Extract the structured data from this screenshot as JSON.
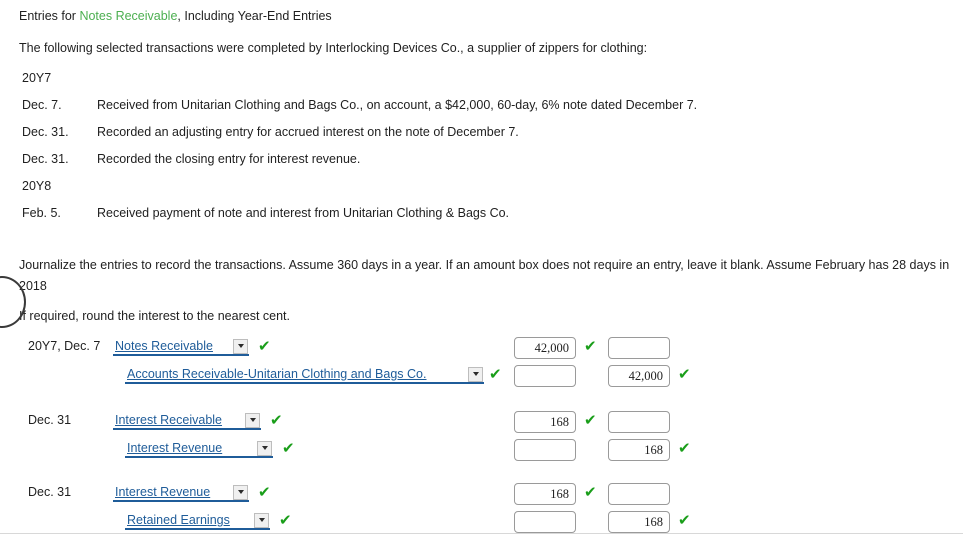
{
  "header": {
    "title_before": "Entries for ",
    "title_highlight": "Notes Receivable",
    "title_after": ", Including Year-End Entries",
    "intro": "The following selected transactions were completed by Interlocking Devices Co., a supplier of zippers for clothing:"
  },
  "transactions": {
    "year_1": "20Y7",
    "year_2": "20Y8",
    "items": [
      {
        "date": "Dec. 7.",
        "desc": "Received from Unitarian Clothing and Bags Co., on account, a $42,000, 60-day, 6% note dated December 7."
      },
      {
        "date": "Dec. 31.",
        "desc": "Recorded an adjusting entry for accrued interest on the note of December 7."
      },
      {
        "date": "Dec. 31.",
        "desc": "Recorded the closing entry for interest revenue."
      },
      {
        "date": "Feb. 5.",
        "desc": "Received payment of note and interest from Unitarian Clothing & Bags Co."
      }
    ]
  },
  "instructions": {
    "main": "Journalize the entries to record the transactions. Assume 360 days in a year. If an amount box does not require an entry, leave it blank. Assume February has 28 days in 2018",
    "rounding": "If required, round the interest to the nearest cent."
  },
  "journal": {
    "check_glyph": "✔",
    "entries": [
      {
        "date": "20Y7, Dec. 7",
        "lines": [
          {
            "account": "Notes Receivable",
            "account_checked": true,
            "debit": "42,000",
            "debit_checked": true,
            "credit": "",
            "credit_checked": false
          },
          {
            "account": "Accounts Receivable-Unitarian Clothing and Bags Co.",
            "account_checked": true,
            "debit": "",
            "debit_checked": false,
            "credit": "42,000",
            "credit_checked": true
          }
        ]
      },
      {
        "date": "Dec. 31",
        "lines": [
          {
            "account": "Interest Receivable",
            "account_checked": true,
            "debit": "168",
            "debit_checked": true,
            "credit": "",
            "credit_checked": false
          },
          {
            "account": "Interest Revenue",
            "account_checked": true,
            "debit": "",
            "debit_checked": false,
            "credit": "168",
            "credit_checked": true
          }
        ]
      },
      {
        "date": "Dec. 31",
        "lines": [
          {
            "account": "Interest Revenue",
            "account_checked": true,
            "debit": "168",
            "debit_checked": true,
            "credit": "",
            "credit_checked": false
          },
          {
            "account": "Retained Earnings",
            "account_checked": true,
            "debit": "",
            "debit_checked": false,
            "credit": "168",
            "credit_checked": true
          }
        ]
      }
    ]
  },
  "colors": {
    "highlight_green": "#4caf50",
    "check_green": "#1a9e1a",
    "link_blue": "#1f5c99"
  }
}
